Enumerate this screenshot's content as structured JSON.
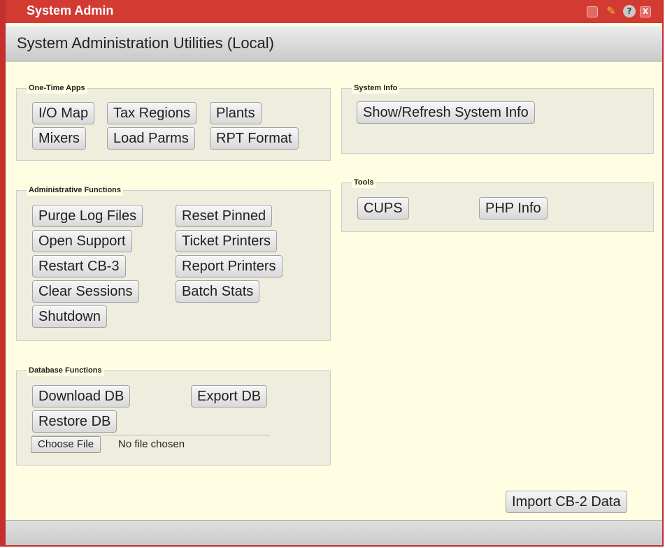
{
  "window": {
    "title": "System Admin",
    "icons": {
      "maximize": "maximize-icon",
      "pin": "pin-icon",
      "help": "?",
      "close": "X"
    }
  },
  "header": {
    "title": "System Administration Utilities (Local)"
  },
  "one_time_apps": {
    "legend": "One-Time Apps",
    "buttons": [
      "I/O Map",
      "Tax Regions",
      "Plants",
      "Mixers",
      "Load Parms",
      "RPT Format"
    ]
  },
  "system_info": {
    "legend": "System Info",
    "buttons": [
      "Show/Refresh System Info"
    ]
  },
  "tools": {
    "legend": "Tools",
    "buttons": [
      "CUPS",
      "PHP Info"
    ]
  },
  "admin_functions": {
    "legend": "Administrative Functions",
    "buttons": [
      "Purge Log Files",
      "Open Support",
      "Restart CB-3",
      "Clear Sessions",
      "Shutdown",
      "Reset Pinned",
      "Ticket Printers",
      "Report Printers",
      "Batch Stats"
    ]
  },
  "database_functions": {
    "legend": "Database Functions",
    "buttons": [
      "Download DB",
      "Export DB",
      "Restore DB"
    ],
    "file_input": {
      "button_label": "Choose File",
      "status": "No file chosen"
    }
  },
  "import_button": "Import CB-2 Data",
  "colors": {
    "title_bar": "#d33a32",
    "background": "#fffde2",
    "panel": "#eeedde"
  }
}
